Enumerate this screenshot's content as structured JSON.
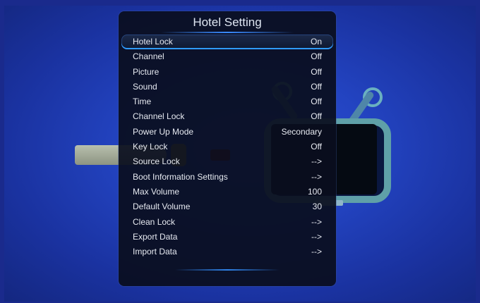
{
  "menu": {
    "title": "Hotel Setting",
    "items": [
      {
        "label": "Hotel Lock",
        "value": "On"
      },
      {
        "label": "Channel",
        "value": "Off"
      },
      {
        "label": "Picture",
        "value": "Off"
      },
      {
        "label": "Sound",
        "value": "Off"
      },
      {
        "label": "Time",
        "value": "Off"
      },
      {
        "label": "Channel Lock",
        "value": "Off"
      },
      {
        "label": "Power Up Mode",
        "value": "Secondary"
      },
      {
        "label": "Key Lock",
        "value": "Off"
      },
      {
        "label": "Source Lock",
        "value": "-->"
      },
      {
        "label": "Boot Information Settings",
        "value": "-->"
      },
      {
        "label": "Max Volume",
        "value": "100"
      },
      {
        "label": "Default Volume",
        "value": "30"
      },
      {
        "label": "Clean Lock",
        "value": "-->"
      },
      {
        "label": "Export Data",
        "value": "-->"
      },
      {
        "label": "Import Data",
        "value": "-->"
      }
    ]
  },
  "colors": {
    "accent": "#2f9bff",
    "panel": "#0a0e1e",
    "background": "#2344c2"
  }
}
